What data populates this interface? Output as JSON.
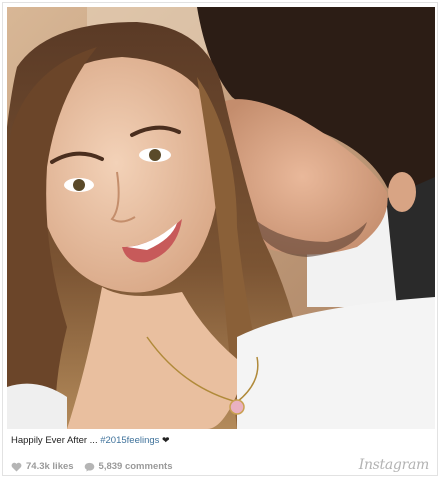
{
  "caption": {
    "text": "Happily Ever After ... ",
    "hashtag": "#2015feelings",
    "heart": "❤"
  },
  "stats": {
    "likes": "74.3k likes",
    "comments": "5,839 comments"
  },
  "brand": "Instagram",
  "colors": {
    "hashtag": "#3f729b",
    "stats": "#9a9a9a",
    "brand": "#b3b3b3"
  }
}
